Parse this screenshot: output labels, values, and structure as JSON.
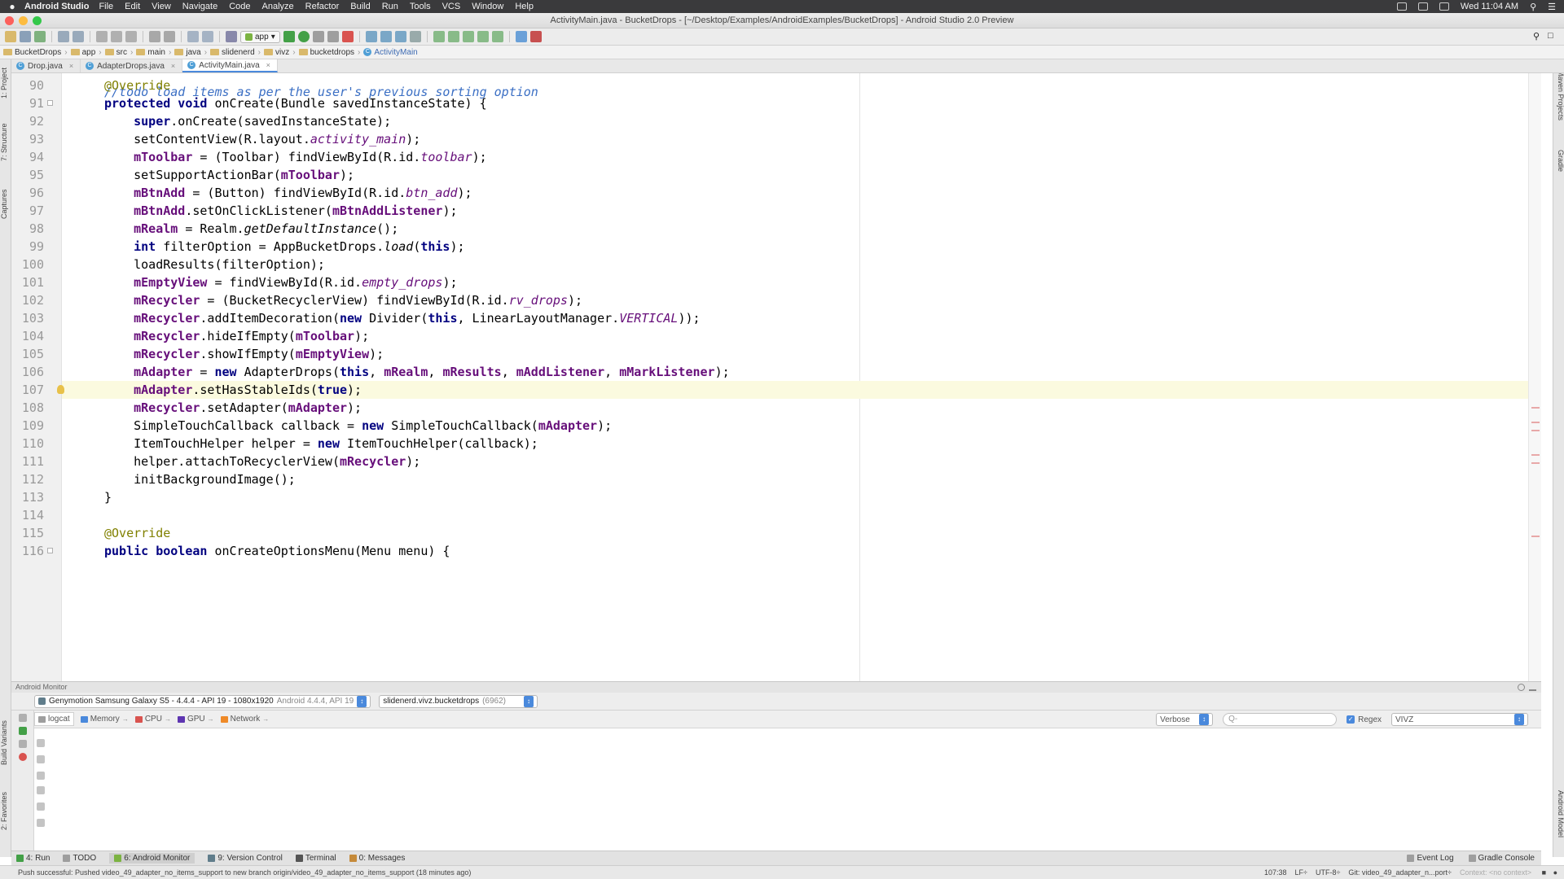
{
  "menubar": {
    "app_name": "Android Studio",
    "items": [
      "File",
      "Edit",
      "View",
      "Navigate",
      "Code",
      "Analyze",
      "Refactor",
      "Build",
      "Run",
      "Tools",
      "VCS",
      "Window",
      "Help"
    ],
    "clock": "Wed 11:04 AM"
  },
  "window": {
    "title": "ActivityMain.java - BucketDrops - [~/Desktop/Examples/AndroidExamples/BucketDrops] - Android Studio 2.0 Preview"
  },
  "toolbar": {
    "run_config": "app"
  },
  "breadcrumb": [
    "BucketDrops",
    "app",
    "src",
    "main",
    "java",
    "slidenerd",
    "vivz",
    "bucketdrops",
    "ActivityMain"
  ],
  "tabs": [
    {
      "label": "Drop.java",
      "active": false
    },
    {
      "label": "AdapterDrops.java",
      "active": false
    },
    {
      "label": "ActivityMain.java",
      "active": true
    }
  ],
  "left_tools": [
    "1: Project",
    "7: Structure",
    "Captures",
    "Build Variants",
    "2: Favorites"
  ],
  "right_tools": [
    "Maven Projects",
    "Gradle",
    "Android Model"
  ],
  "editor": {
    "partial_top_line": "//todo load items as per the user's previous sorting option",
    "current_line": 107,
    "lines": [
      {
        "n": "90",
        "html": "<span class=\"ann\">@Override</span>"
      },
      {
        "n": "91",
        "html": "<span class=\"kw\">protected void</span> onCreate(Bundle savedInstanceState) {"
      },
      {
        "n": "92",
        "html": "    <span class=\"kw\">super</span>.onCreate(savedInstanceState);"
      },
      {
        "n": "93",
        "html": "    setContentView(R.layout.<span class=\"it\">activity_main</span>);"
      },
      {
        "n": "94",
        "html": "    <span class=\"fld\">mToolbar</span> = (Toolbar) findViewById(R.id.<span class=\"it\">toolbar</span>);"
      },
      {
        "n": "95",
        "html": "    setSupportActionBar(<span class=\"fld\">mToolbar</span>);"
      },
      {
        "n": "96",
        "html": "    <span class=\"fld\">mBtnAdd</span> = (Button) findViewById(R.id.<span class=\"it\">btn_add</span>);"
      },
      {
        "n": "97",
        "html": "    <span class=\"fld\">mBtnAdd</span>.setOnClickListener(<span class=\"fld\">mBtnAddListener</span>);"
      },
      {
        "n": "98",
        "html": "    <span class=\"fld\">mRealm</span> = Realm.<span class=\"itp\">getDefaultInstance</span>();"
      },
      {
        "n": "99",
        "html": "    <span class=\"kw\">int</span> filterOption = AppBucketDrops.<span class=\"itp\">load</span>(<span class=\"kw\">this</span>);"
      },
      {
        "n": "100",
        "html": "    loadResults(filterOption);"
      },
      {
        "n": "101",
        "html": "    <span class=\"fld\">mEmptyView</span> = findViewById(R.id.<span class=\"it\">empty_drops</span>);"
      },
      {
        "n": "102",
        "html": "    <span class=\"fld\">mRecycler</span> = (BucketRecyclerView) findViewById(R.id.<span class=\"it\">rv_drops</span>);"
      },
      {
        "n": "103",
        "html": "    <span class=\"fld\">mRecycler</span>.addItemDecoration(<span class=\"kw\">new</span> Divider(<span class=\"kw\">this</span>, LinearLayoutManager.<span class=\"it\">VERTICAL</span>));"
      },
      {
        "n": "104",
        "html": "    <span class=\"fld\">mRecycler</span>.hideIfEmpty(<span class=\"fld\">mToolbar</span>);"
      },
      {
        "n": "105",
        "html": "    <span class=\"fld\">mRecycler</span>.showIfEmpty(<span class=\"fld\">mEmptyView</span>);"
      },
      {
        "n": "106",
        "html": "    <span class=\"fld\">mAdapter</span> = <span class=\"kw\">new</span> AdapterDrops(<span class=\"kw\">this</span>, <span class=\"fld\">mRealm</span>, <span class=\"fld\">mResults</span>, <span class=\"fld\">mAddListener</span>, <span class=\"fld\">mMarkListener</span>);"
      },
      {
        "n": "107",
        "html": "    <span class=\"fld\">mAdapter</span>.setHasStableIds(<span class=\"kw\">true</span>);"
      },
      {
        "n": "108",
        "html": "    <span class=\"fld\">mRecycler</span>.setAdapter(<span class=\"fld\">mAdapter</span>);"
      },
      {
        "n": "109",
        "html": "    SimpleTouchCallback callback = <span class=\"kw\">new</span> SimpleTouchCallback(<span class=\"fld\">mAdapter</span>);"
      },
      {
        "n": "110",
        "html": "    ItemTouchHelper helper = <span class=\"kw\">new</span> ItemTouchHelper(callback);"
      },
      {
        "n": "111",
        "html": "    helper.attachToRecyclerView(<span class=\"fld\">mRecycler</span>);"
      },
      {
        "n": "112",
        "html": "    initBackgroundImage();"
      },
      {
        "n": "113",
        "html": "}"
      },
      {
        "n": "114",
        "html": ""
      },
      {
        "n": "115",
        "html": "<span class=\"ann\">@Override</span>"
      },
      {
        "n": "116",
        "html": "<span class=\"kw\">public boolean</span> onCreateOptionsMenu(Menu menu) {"
      }
    ]
  },
  "monitor": {
    "title": "Android Monitor",
    "device": "Genymotion Samsung Galaxy S5 - 4.4.4 - API 19 - 1080x1920",
    "device_detail": "Android 4.4.4, API 19",
    "process": "slidenerd.vivz.bucketdrops",
    "process_pid": "(6962)",
    "tabs": [
      "logcat",
      "Memory",
      "CPU",
      "GPU",
      "Network"
    ],
    "log_level": "Verbose",
    "search_placeholder": "Q-",
    "regex_label": "Regex",
    "filter": "VIVZ"
  },
  "tool_windows": [
    "4: Run",
    "TODO",
    "6: Android Monitor",
    "9: Version Control",
    "Terminal",
    "0: Messages"
  ],
  "tool_windows_right": [
    "Event Log",
    "Gradle Console"
  ],
  "status": {
    "message": "Push successful: Pushed video_49_adapter_no_items_support to new branch origin/video_49_adapter_no_items_support (18 minutes ago)",
    "position": "107:38",
    "line_sep": "LF÷",
    "encoding": "UTF-8÷",
    "git": "Git: video_49_adapter_n...port÷",
    "context": "Context: <no context>"
  },
  "colors": {
    "keyword": "#000080",
    "field": "#660e7a",
    "annotation": "#808000",
    "current_line": "#fbfadf",
    "accent": "#4a89dc"
  }
}
